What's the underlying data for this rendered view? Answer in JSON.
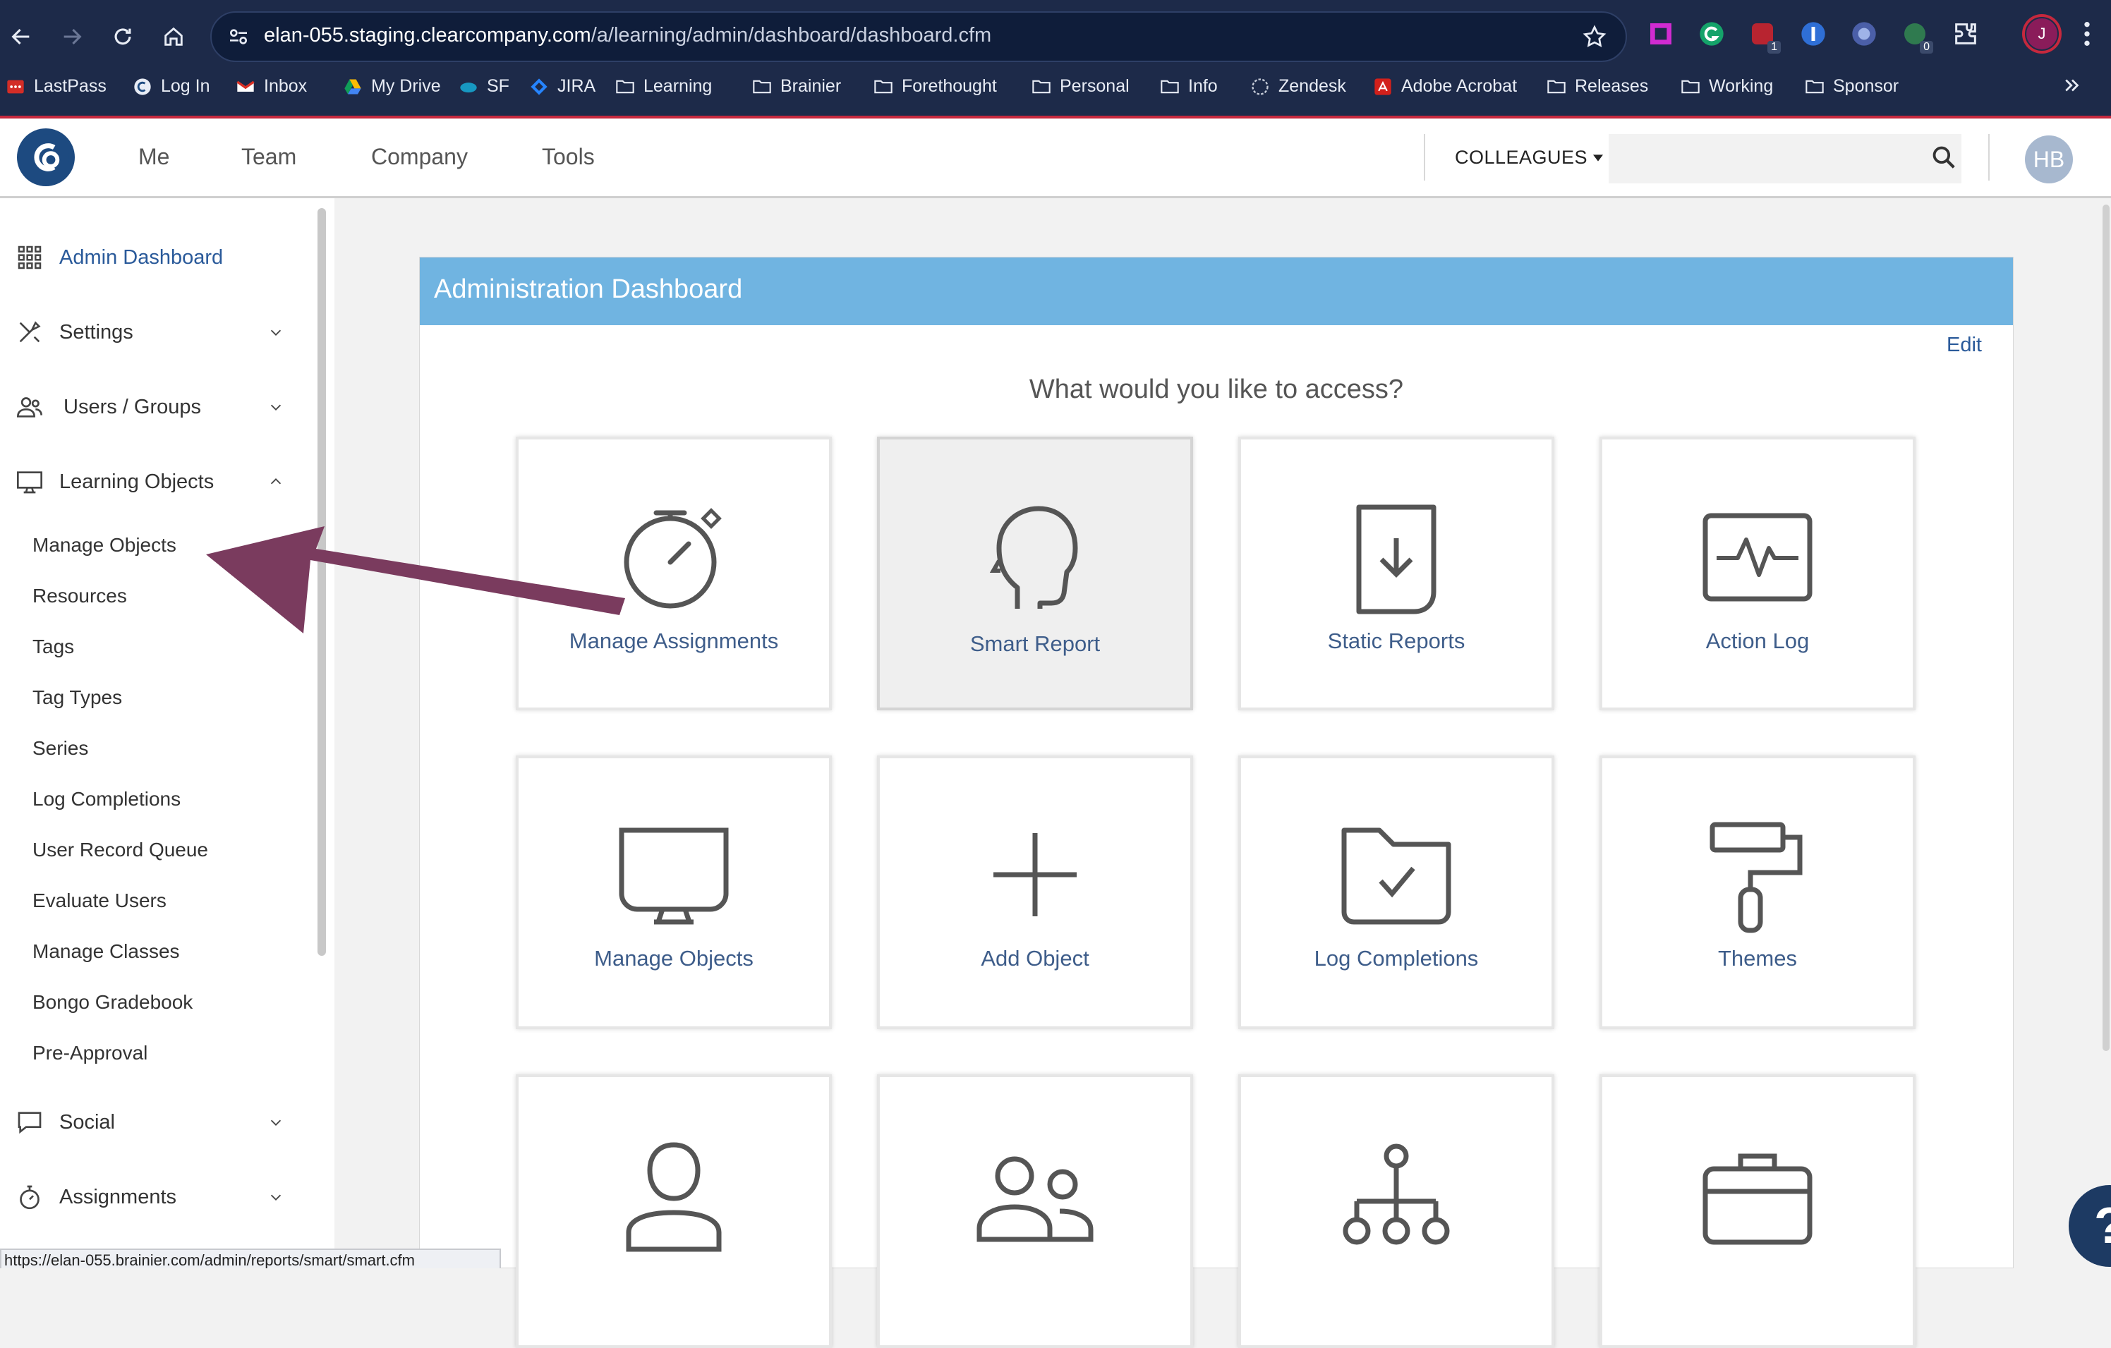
{
  "browser": {
    "url_host": "elan-055.staging.clearcompany.com",
    "url_path": "/a/learning/admin/dashboard/dashboard.cfm",
    "profile_initial": "J",
    "extension_badges": [
      "1",
      "0"
    ],
    "bookmarks": [
      {
        "label": "LastPass",
        "icon": "lastpass-icon"
      },
      {
        "label": "Log In",
        "icon": "clearcompany-icon"
      },
      {
        "label": "Inbox",
        "icon": "gmail-icon"
      },
      {
        "label": "My Drive",
        "icon": "drive-icon"
      },
      {
        "label": "SF",
        "icon": "salesforce-icon"
      },
      {
        "label": "JIRA",
        "icon": "jira-icon"
      },
      {
        "label": "Learning",
        "icon": "folder-icon"
      },
      {
        "label": "Brainier",
        "icon": "folder-icon"
      },
      {
        "label": "Forethought",
        "icon": "folder-icon"
      },
      {
        "label": "Personal",
        "icon": "folder-icon"
      },
      {
        "label": "Info",
        "icon": "folder-icon"
      },
      {
        "label": "Zendesk",
        "icon": "zendesk-icon"
      },
      {
        "label": "Adobe Acrobat",
        "icon": "acrobat-icon"
      },
      {
        "label": "Releases",
        "icon": "folder-icon"
      },
      {
        "label": "Working",
        "icon": "folder-icon"
      },
      {
        "label": "Sponsor",
        "icon": "folder-icon"
      }
    ]
  },
  "header": {
    "nav": [
      "Me",
      "Team",
      "Company",
      "Tools"
    ],
    "colleagues_label": "COLLEAGUES",
    "search_placeholder": "",
    "avatar_initials": "HB"
  },
  "sidebar": {
    "sections_top": [
      {
        "label": "Admin Dashboard",
        "icon": "grid-icon",
        "active": true
      },
      {
        "label": "Settings",
        "icon": "tools-icon"
      },
      {
        "label": "Users / Groups",
        "icon": "users-icon"
      },
      {
        "label": "Learning Objects",
        "icon": "monitor-icon",
        "expanded": true
      }
    ],
    "learning_objects_items": [
      "Manage Objects",
      "Resources",
      "Tags",
      "Tag Types",
      "Series",
      "Log Completions",
      "User Record Queue",
      "Evaluate Users",
      "Manage Classes",
      "Bongo Gradebook",
      "Pre-Approval"
    ],
    "sections_bottom": [
      {
        "label": "Social",
        "icon": "chat-icon"
      },
      {
        "label": "Assignments",
        "icon": "stopwatch-icon"
      }
    ]
  },
  "main": {
    "panel_title": "Administration Dashboard",
    "edit_label": "Edit",
    "prompt": "What would you like to access?",
    "tiles": [
      {
        "label": "Manage Assignments",
        "icon": "stopwatch-icon"
      },
      {
        "label": "Smart Report",
        "icon": "head-icon",
        "active": true
      },
      {
        "label": "Static Reports",
        "icon": "document-download-icon"
      },
      {
        "label": "Action Log",
        "icon": "pulse-icon"
      },
      {
        "label": "Manage Objects",
        "icon": "monitor-icon"
      },
      {
        "label": "Add Object",
        "icon": "plus-icon"
      },
      {
        "label": "Log Completions",
        "icon": "folder-check-icon"
      },
      {
        "label": "Themes",
        "icon": "paint-roller-icon"
      },
      {
        "label": "",
        "icon": "user-icon"
      },
      {
        "label": "",
        "icon": "users-icon"
      },
      {
        "label": "",
        "icon": "org-chart-icon"
      },
      {
        "label": "",
        "icon": "briefcase-icon"
      }
    ]
  },
  "status_bar_url": "https://elan-055.brainier.com/admin/reports/smart/smart.cfm",
  "help_label": "?",
  "colors": {
    "chrome_bg": "#1d2a49",
    "panel_header": "#70b4e1",
    "link_blue": "#2a5a9a",
    "tile_label": "#3e5d8a",
    "arrow": "#7a3b5e"
  }
}
